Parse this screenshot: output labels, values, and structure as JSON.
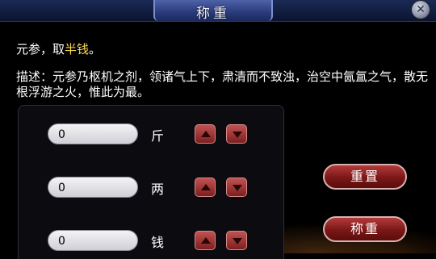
{
  "window": {
    "title": "称重",
    "close_label": "✕"
  },
  "item": {
    "prefix": "元参，取",
    "amount": "半钱",
    "suffix": "。"
  },
  "description": "描述：元参乃枢机之剂，领诸气上下，肃清而不致浊，治空中氤氲之气，散无根浮游之火，惟此为最。",
  "weights": [
    {
      "unit": "斤",
      "value": "0"
    },
    {
      "unit": "两",
      "value": "0"
    },
    {
      "unit": "钱",
      "value": "0"
    }
  ],
  "buttons": {
    "reset": "重置",
    "weigh": "称重"
  },
  "colors": {
    "highlight": "#ffd84a",
    "button_red": "#7a1717"
  }
}
